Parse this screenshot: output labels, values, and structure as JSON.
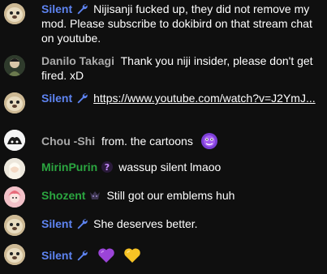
{
  "colors": {
    "background": "#0f0f0f",
    "moderator_name": "#5e84f1",
    "default_name": "#aaaaaa",
    "member_name": "#2ba640",
    "text": "#ffffff"
  },
  "messages": [
    {
      "author": "Silent",
      "role": "moderator",
      "badge_icon": "wrench-icon",
      "text": "Nijisanji fucked up, they did not remove my mod. Please subscribe to dokibird on that stream chat on youtube."
    },
    {
      "author": "Danilo Takagi",
      "role": "viewer",
      "text": "Thank you niji insider, please don't get fired. xD"
    },
    {
      "author": "Silent",
      "role": "moderator",
      "badge_icon": "wrench-icon",
      "link": "https://www.youtube.com/watch?v=J2YmJ..."
    },
    {
      "author": "Chou -Shi",
      "role": "viewer",
      "text": "from. the cartoons",
      "emoji_icon": "purple-genie-emoji"
    },
    {
      "author": "MirinPurin",
      "role": "member",
      "badge_icon": "member-badge-icon",
      "text": "wassup silent lmaoo"
    },
    {
      "author": "Shozent",
      "role": "member",
      "badge_icon": "member-badge-icon",
      "text": "Still got our emblems huh"
    },
    {
      "author": "Silent",
      "role": "moderator",
      "badge_icon": "wrench-icon",
      "text": "She deserves better."
    },
    {
      "author": "Silent",
      "role": "moderator",
      "badge_icon": "wrench-icon",
      "emojis": [
        "purple-heart-emoji",
        "yellow-heart-emoji"
      ]
    }
  ]
}
